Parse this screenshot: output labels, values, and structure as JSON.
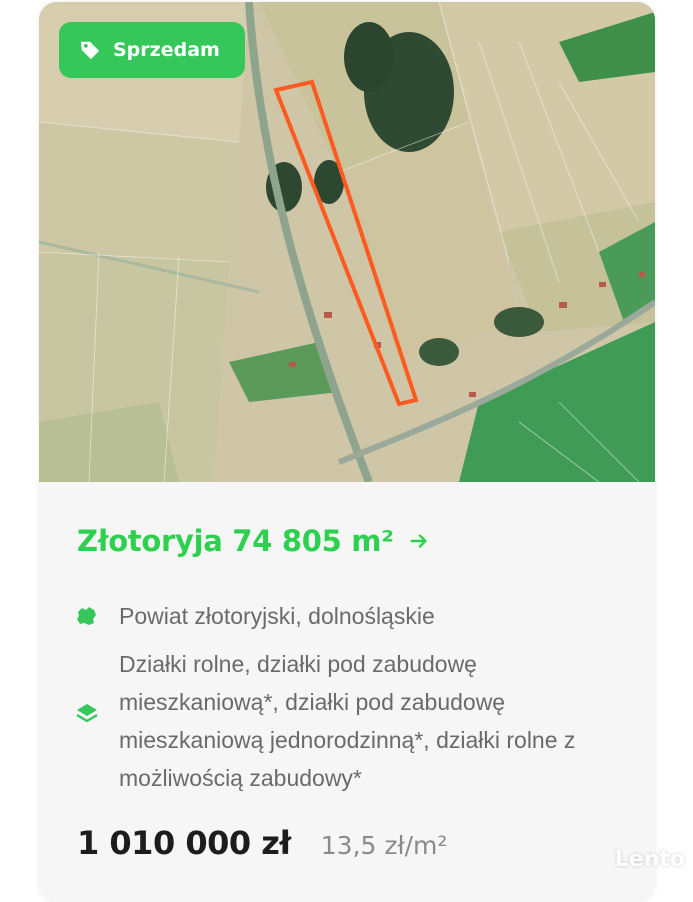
{
  "listing": {
    "badge_label": "Sprzedam",
    "title": "Złotoryja 74 805 m²",
    "location": "Powiat złotoryjski, dolnośląskie",
    "plot_types": "Działki rolne, działki pod zabudowę mieszkaniową*, działki pod zabudowę mieszkaniową jednorodzinną*, działki rolne z możliwością zabudowy*",
    "price": "1 010 000 zł",
    "price_per_m2": "13,5 zł/m²"
  },
  "icons": {
    "badge": "tag-icon",
    "title": "arrow-right-icon",
    "location": "region-map-icon",
    "plot_types": "layers-icon"
  },
  "colors": {
    "accent": "#35c75a",
    "title": "#2ed14f",
    "parcel_outline": "#ff5a1f"
  },
  "watermark": "Lento"
}
